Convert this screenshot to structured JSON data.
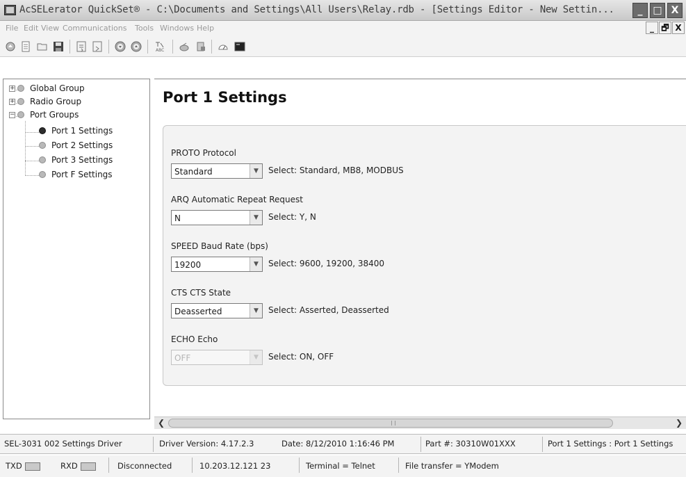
{
  "window": {
    "title": "AcSELerator QuickSet® - C:\\Documents and Settings\\All Users\\Relay.rdb - [Settings Editor - New Settin...",
    "minimize": "_",
    "maximize": "□",
    "close": "X"
  },
  "menu": {
    "items": [
      "File",
      "Edit",
      "View",
      "Communications",
      "Tools",
      "Windows",
      "Help"
    ]
  },
  "mdi": {
    "minimize": "_",
    "restore": "🗗",
    "close": "X"
  },
  "tree": {
    "nodes": [
      {
        "label": "Global Group",
        "expander": "+"
      },
      {
        "label": "Radio Group",
        "expander": "+"
      },
      {
        "label": "Port Groups",
        "expander": "−"
      },
      {
        "label": "Port 1 Settings",
        "selected": true
      },
      {
        "label": "Port 2 Settings"
      },
      {
        "label": "Port 3 Settings"
      },
      {
        "label": "Port F Settings"
      }
    ]
  },
  "page": {
    "title": "Port 1 Settings",
    "settings": [
      {
        "label": "PROTO  Protocol",
        "value": "Standard",
        "hint": "Select: Standard, MB8, MODBUS",
        "enabled": true
      },
      {
        "label": "ARQ  Automatic Repeat Request",
        "value": "N",
        "hint": "Select: Y, N",
        "enabled": true
      },
      {
        "label": "SPEED  Baud Rate (bps)",
        "value": "19200",
        "hint": "Select: 9600, 19200, 38400",
        "enabled": true
      },
      {
        "label": "CTS  CTS State",
        "value": "Deasserted",
        "hint": "Select: Asserted, Deasserted",
        "enabled": true
      },
      {
        "label": "ECHO  Echo",
        "value": "OFF",
        "hint": "Select: ON, OFF",
        "enabled": false
      }
    ]
  },
  "status": {
    "driver": "SEL-3031 002 Settings Driver",
    "version": "Driver Version: 4.17.2.3",
    "date": "Date: 8/12/2010 1:16:46 PM",
    "part": "Part #: 30310W01XXX",
    "location": "Port 1 Settings : Port 1 Settings",
    "txd": "TXD",
    "rxd": "RXD",
    "connection": "Disconnected",
    "address": "10.203.12.121  23",
    "terminal": "Terminal = Telnet",
    "transfer": "File transfer = YModem"
  }
}
